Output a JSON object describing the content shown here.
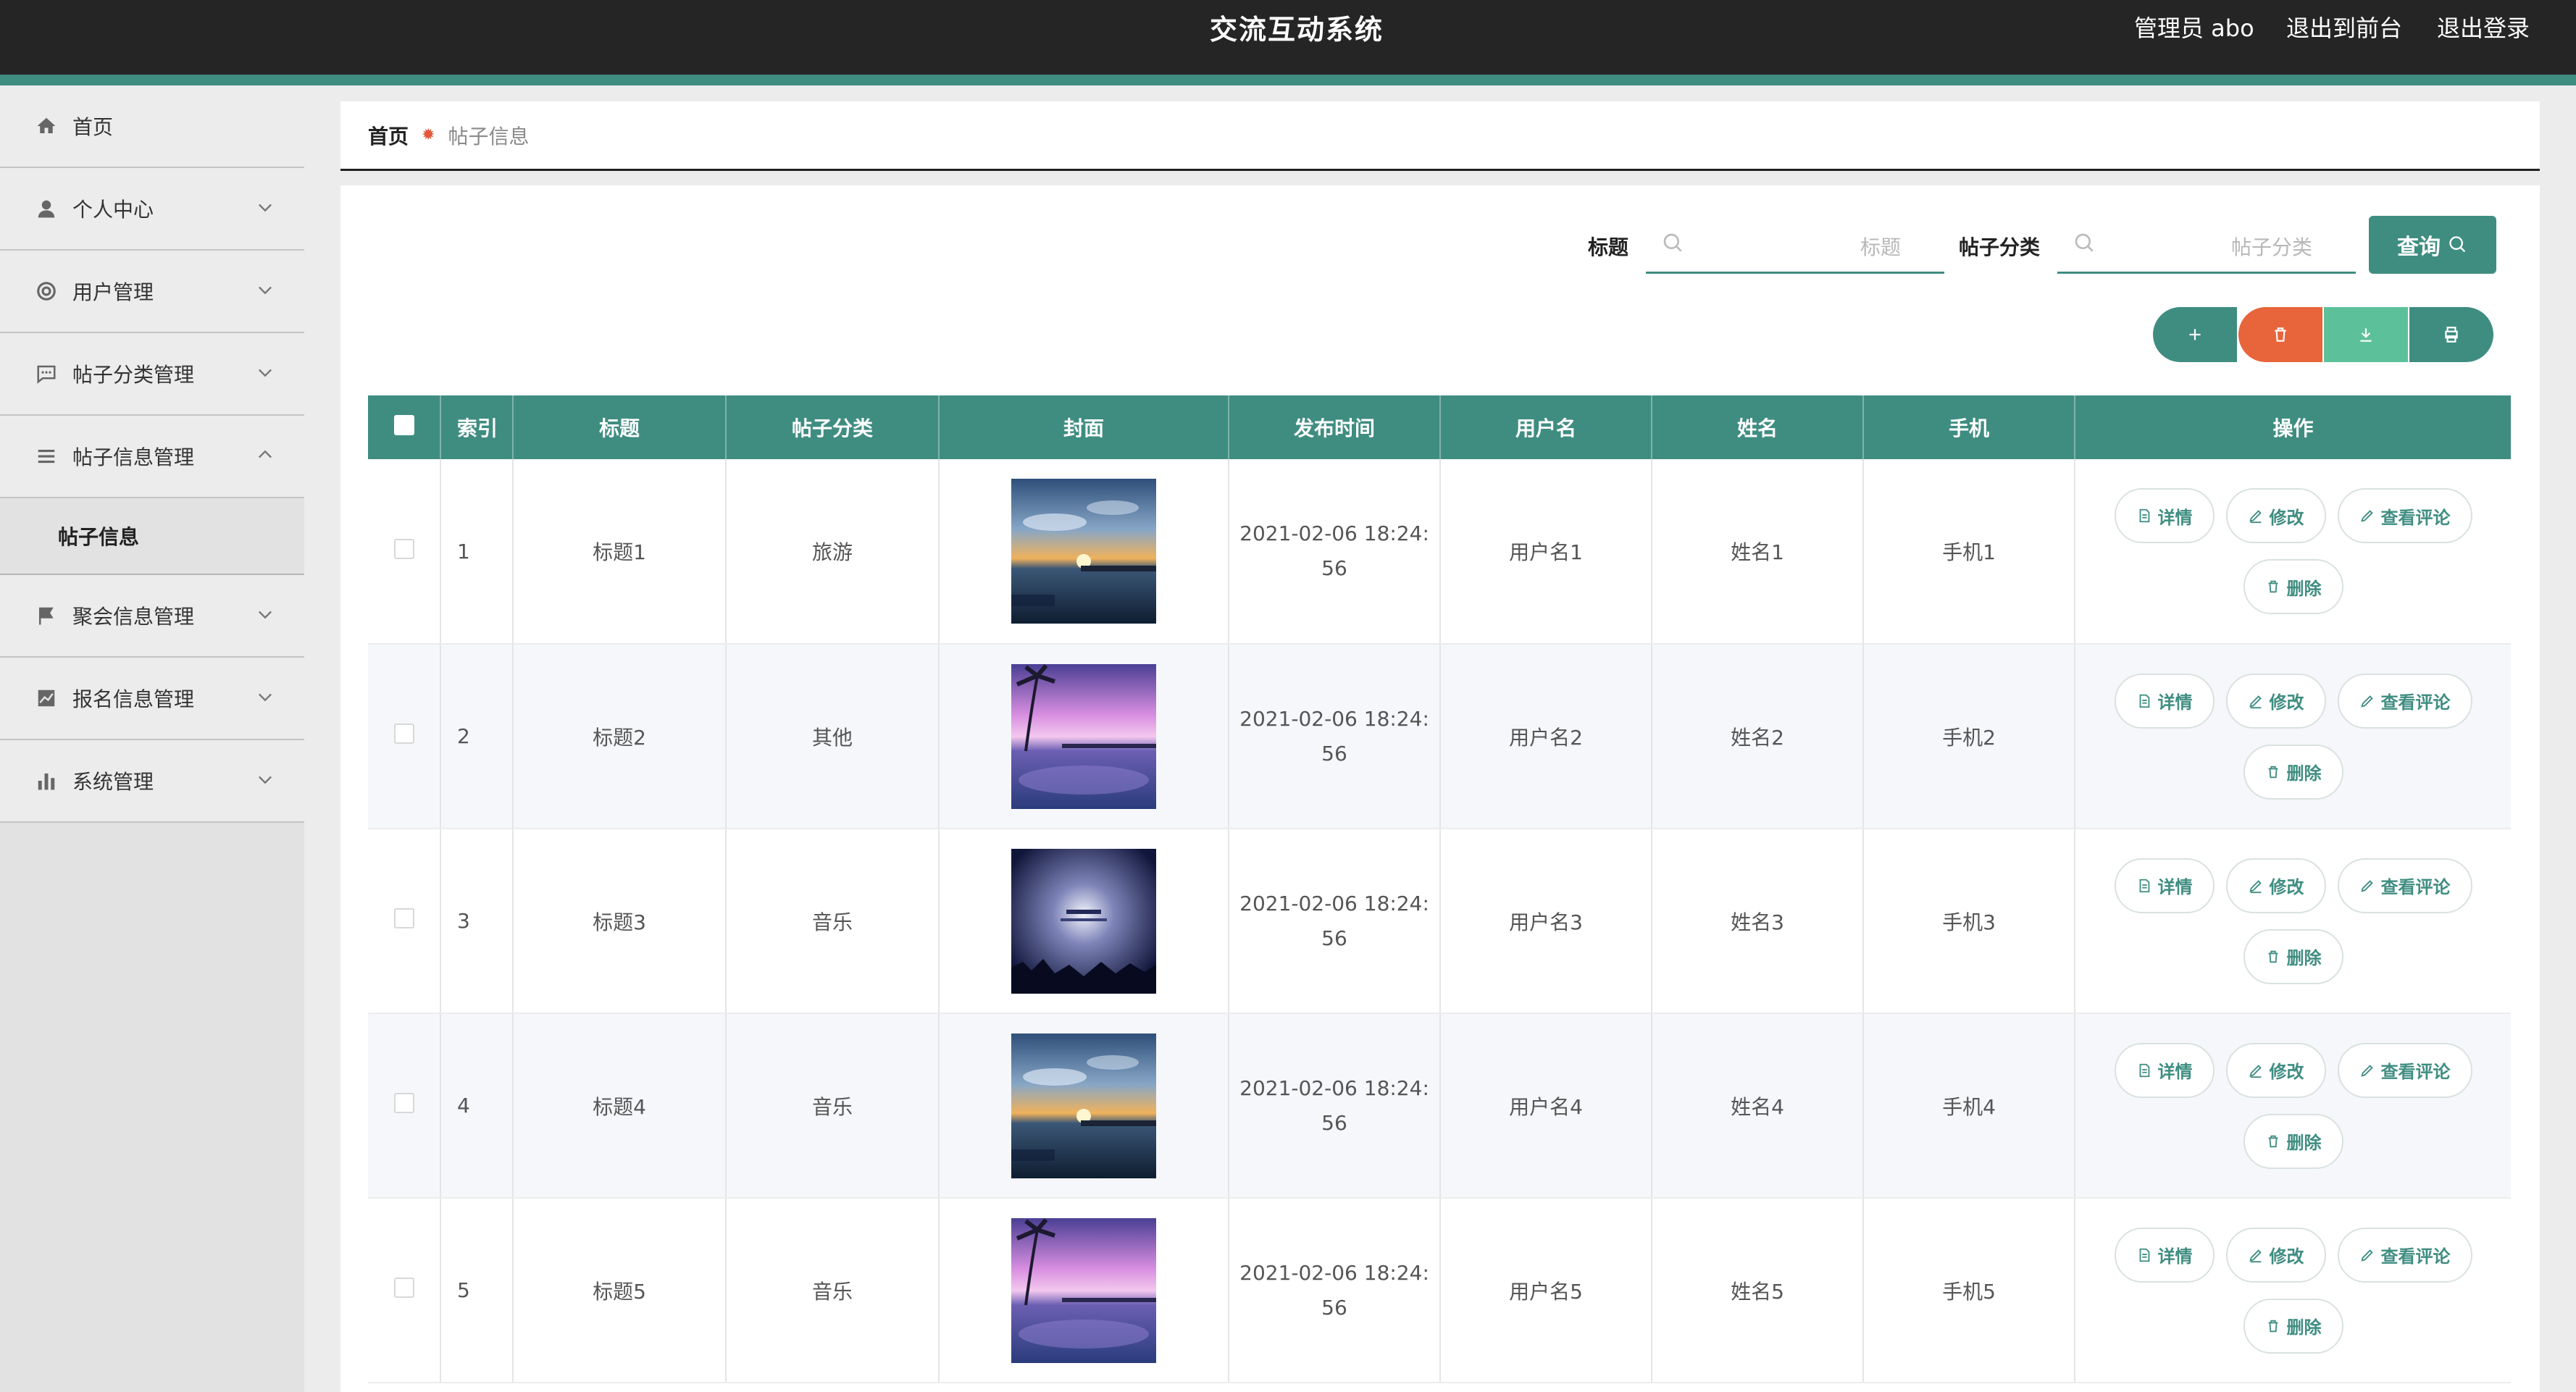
{
  "header": {
    "title": "交流互动系统",
    "user_label": "管理员 abo",
    "front_link": "退出到前台",
    "logout_link": "退出登录"
  },
  "sidebar": {
    "items": [
      {
        "label": "首页",
        "icon": "home-icon"
      },
      {
        "label": "个人中心",
        "icon": "user-icon"
      },
      {
        "label": "用户管理",
        "icon": "lifebuoy-icon"
      },
      {
        "label": "帖子分类管理",
        "icon": "chat-icon"
      },
      {
        "label": "帖子信息管理",
        "icon": "list-icon",
        "sub": "帖子信息"
      },
      {
        "label": "聚会信息管理",
        "icon": "flag-icon"
      },
      {
        "label": "报名信息管理",
        "icon": "chart-icon"
      },
      {
        "label": "系统管理",
        "icon": "bar-chart-icon"
      }
    ]
  },
  "breadcrumb": {
    "home": "首页",
    "separator": "✹",
    "current": "帖子信息"
  },
  "search": {
    "title_label": "标题",
    "title_placeholder": "标题",
    "category_label": "帖子分类",
    "category_placeholder": "帖子分类",
    "query_label": "查询"
  },
  "toolbar": {
    "add_icon": "plus-icon",
    "delete_icon": "trash-icon",
    "download_icon": "download-icon",
    "print_icon": "print-icon"
  },
  "table": {
    "columns": [
      "索引",
      "标题",
      "帖子分类",
      "封面",
      "发布时间",
      "用户名",
      "姓名",
      "手机",
      "操作"
    ],
    "ops": {
      "detail": "详情",
      "edit": "修改",
      "comments": "查看评论",
      "delete": "删除"
    },
    "rows": [
      {
        "index": "1",
        "title": "标题1",
        "category": "旅游",
        "time1": "2021-02-06 18:24:",
        "time2": "56",
        "username": "用户名1",
        "name": "姓名1",
        "phone": "手机1",
        "cover": "sunset-pier"
      },
      {
        "index": "2",
        "title": "标题2",
        "category": "其他",
        "time1": "2021-02-06 18:24:",
        "time2": "56",
        "username": "用户名2",
        "name": "姓名2",
        "phone": "手机2",
        "cover": "palm-purple"
      },
      {
        "index": "3",
        "title": "标题3",
        "category": "音乐",
        "time1": "2021-02-06 18:24:",
        "time2": "56",
        "username": "用户名3",
        "name": "姓名3",
        "phone": "手机3",
        "cover": "night-sky"
      },
      {
        "index": "4",
        "title": "标题4",
        "category": "音乐",
        "time1": "2021-02-06 18:24:",
        "time2": "56",
        "username": "用户名4",
        "name": "姓名4",
        "phone": "手机4",
        "cover": "sunset-pier"
      },
      {
        "index": "5",
        "title": "标题5",
        "category": "音乐",
        "time1": "2021-02-06 18:24:",
        "time2": "56",
        "username": "用户名5",
        "name": "姓名5",
        "phone": "手机5",
        "cover": "palm-purple"
      }
    ]
  },
  "colors": {
    "accent": "#3f8d81",
    "danger": "#e8643a",
    "success": "#5cc19a",
    "topbar": "#252525"
  }
}
